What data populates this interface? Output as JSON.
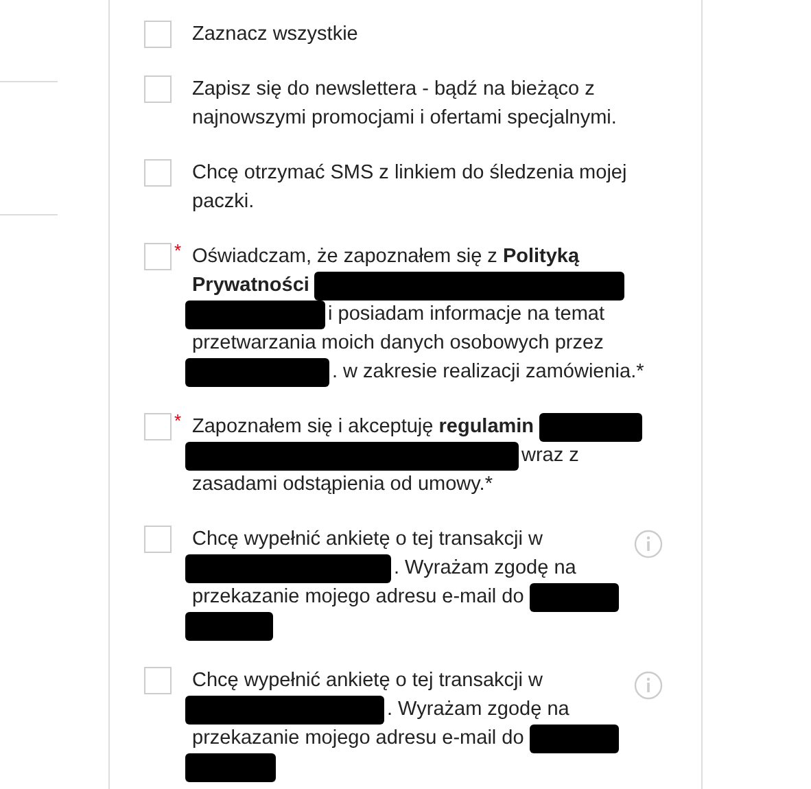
{
  "consents": [
    {
      "checked": false,
      "info": false,
      "lines": [
        [
          {
            "kind": "text",
            "text": "Zaznacz wszystkie"
          }
        ]
      ]
    },
    {
      "checked": false,
      "info": false,
      "lines": [
        [
          {
            "kind": "text",
            "text": "Zapisz się do newslettera - bądź na bieżąco z"
          }
        ],
        [
          {
            "kind": "text",
            "text": "najnowszymi promocjami i ofertami specjalnymi."
          }
        ]
      ]
    },
    {
      "checked": false,
      "info": false,
      "lines": [
        [
          {
            "kind": "text",
            "text": "Chcę otrzymać SMS z linkiem do śledzenia mojej"
          }
        ],
        [
          {
            "kind": "text",
            "text": "paczki."
          }
        ]
      ]
    },
    {
      "checked": false,
      "required_mark": "*",
      "info": false,
      "lines": [
        [
          {
            "kind": "text",
            "text": "Oświadczam, że zapoznałem się z **Polityką**"
          }
        ],
        [
          {
            "kind": "text",
            "text": "**Prywatności**"
          },
          {
            "kind": "redacted"
          }
        ],
        [
          {
            "kind": "redacted"
          },
          {
            "kind": "text",
            "text": "i posiadam informacje na temat"
          }
        ],
        [
          {
            "kind": "text",
            "text": "przetwarzania moich danych osobowych przez"
          }
        ],
        [
          {
            "kind": "redacted"
          },
          {
            "kind": "text",
            "text": ". w zakresie realizacji zamówienia.*"
          }
        ]
      ]
    },
    {
      "checked": false,
      "required_mark": "*",
      "info": false,
      "lines": [
        [
          {
            "kind": "text",
            "text": "Zapoznałem się i akceptuję **regulamin**"
          },
          {
            "kind": "redacted"
          }
        ],
        [
          {
            "kind": "redacted"
          },
          {
            "kind": "text",
            "text": "wraz z"
          }
        ],
        [
          {
            "kind": "text",
            "text": "zasadami odstąpienia od umowy.*"
          }
        ]
      ]
    },
    {
      "checked": false,
      "info": true,
      "lines": [
        [
          {
            "kind": "text",
            "text": "Chcę wypełnić ankietę o tej transakcji w"
          }
        ],
        [
          {
            "kind": "redacted"
          },
          {
            "kind": "text",
            "text": ". Wyrażam zgodę na"
          }
        ],
        [
          {
            "kind": "text",
            "text": "przekazanie mojego adresu e-mail do"
          },
          {
            "kind": "redacted"
          }
        ],
        [
          {
            "kind": "redacted"
          }
        ]
      ]
    },
    {
      "checked": false,
      "info": true,
      "lines": [
        [
          {
            "kind": "text",
            "text": "Chcę wypełnić ankietę o tej transakcji w"
          }
        ],
        [
          {
            "kind": "redacted"
          },
          {
            "kind": "text",
            "text": ". Wyrażam zgodę na"
          }
        ],
        [
          {
            "kind": "text",
            "text": "przekazanie mojego adresu e-mail do"
          },
          {
            "kind": "redacted"
          }
        ],
        [
          {
            "kind": "redacted"
          }
        ]
      ]
    }
  ]
}
